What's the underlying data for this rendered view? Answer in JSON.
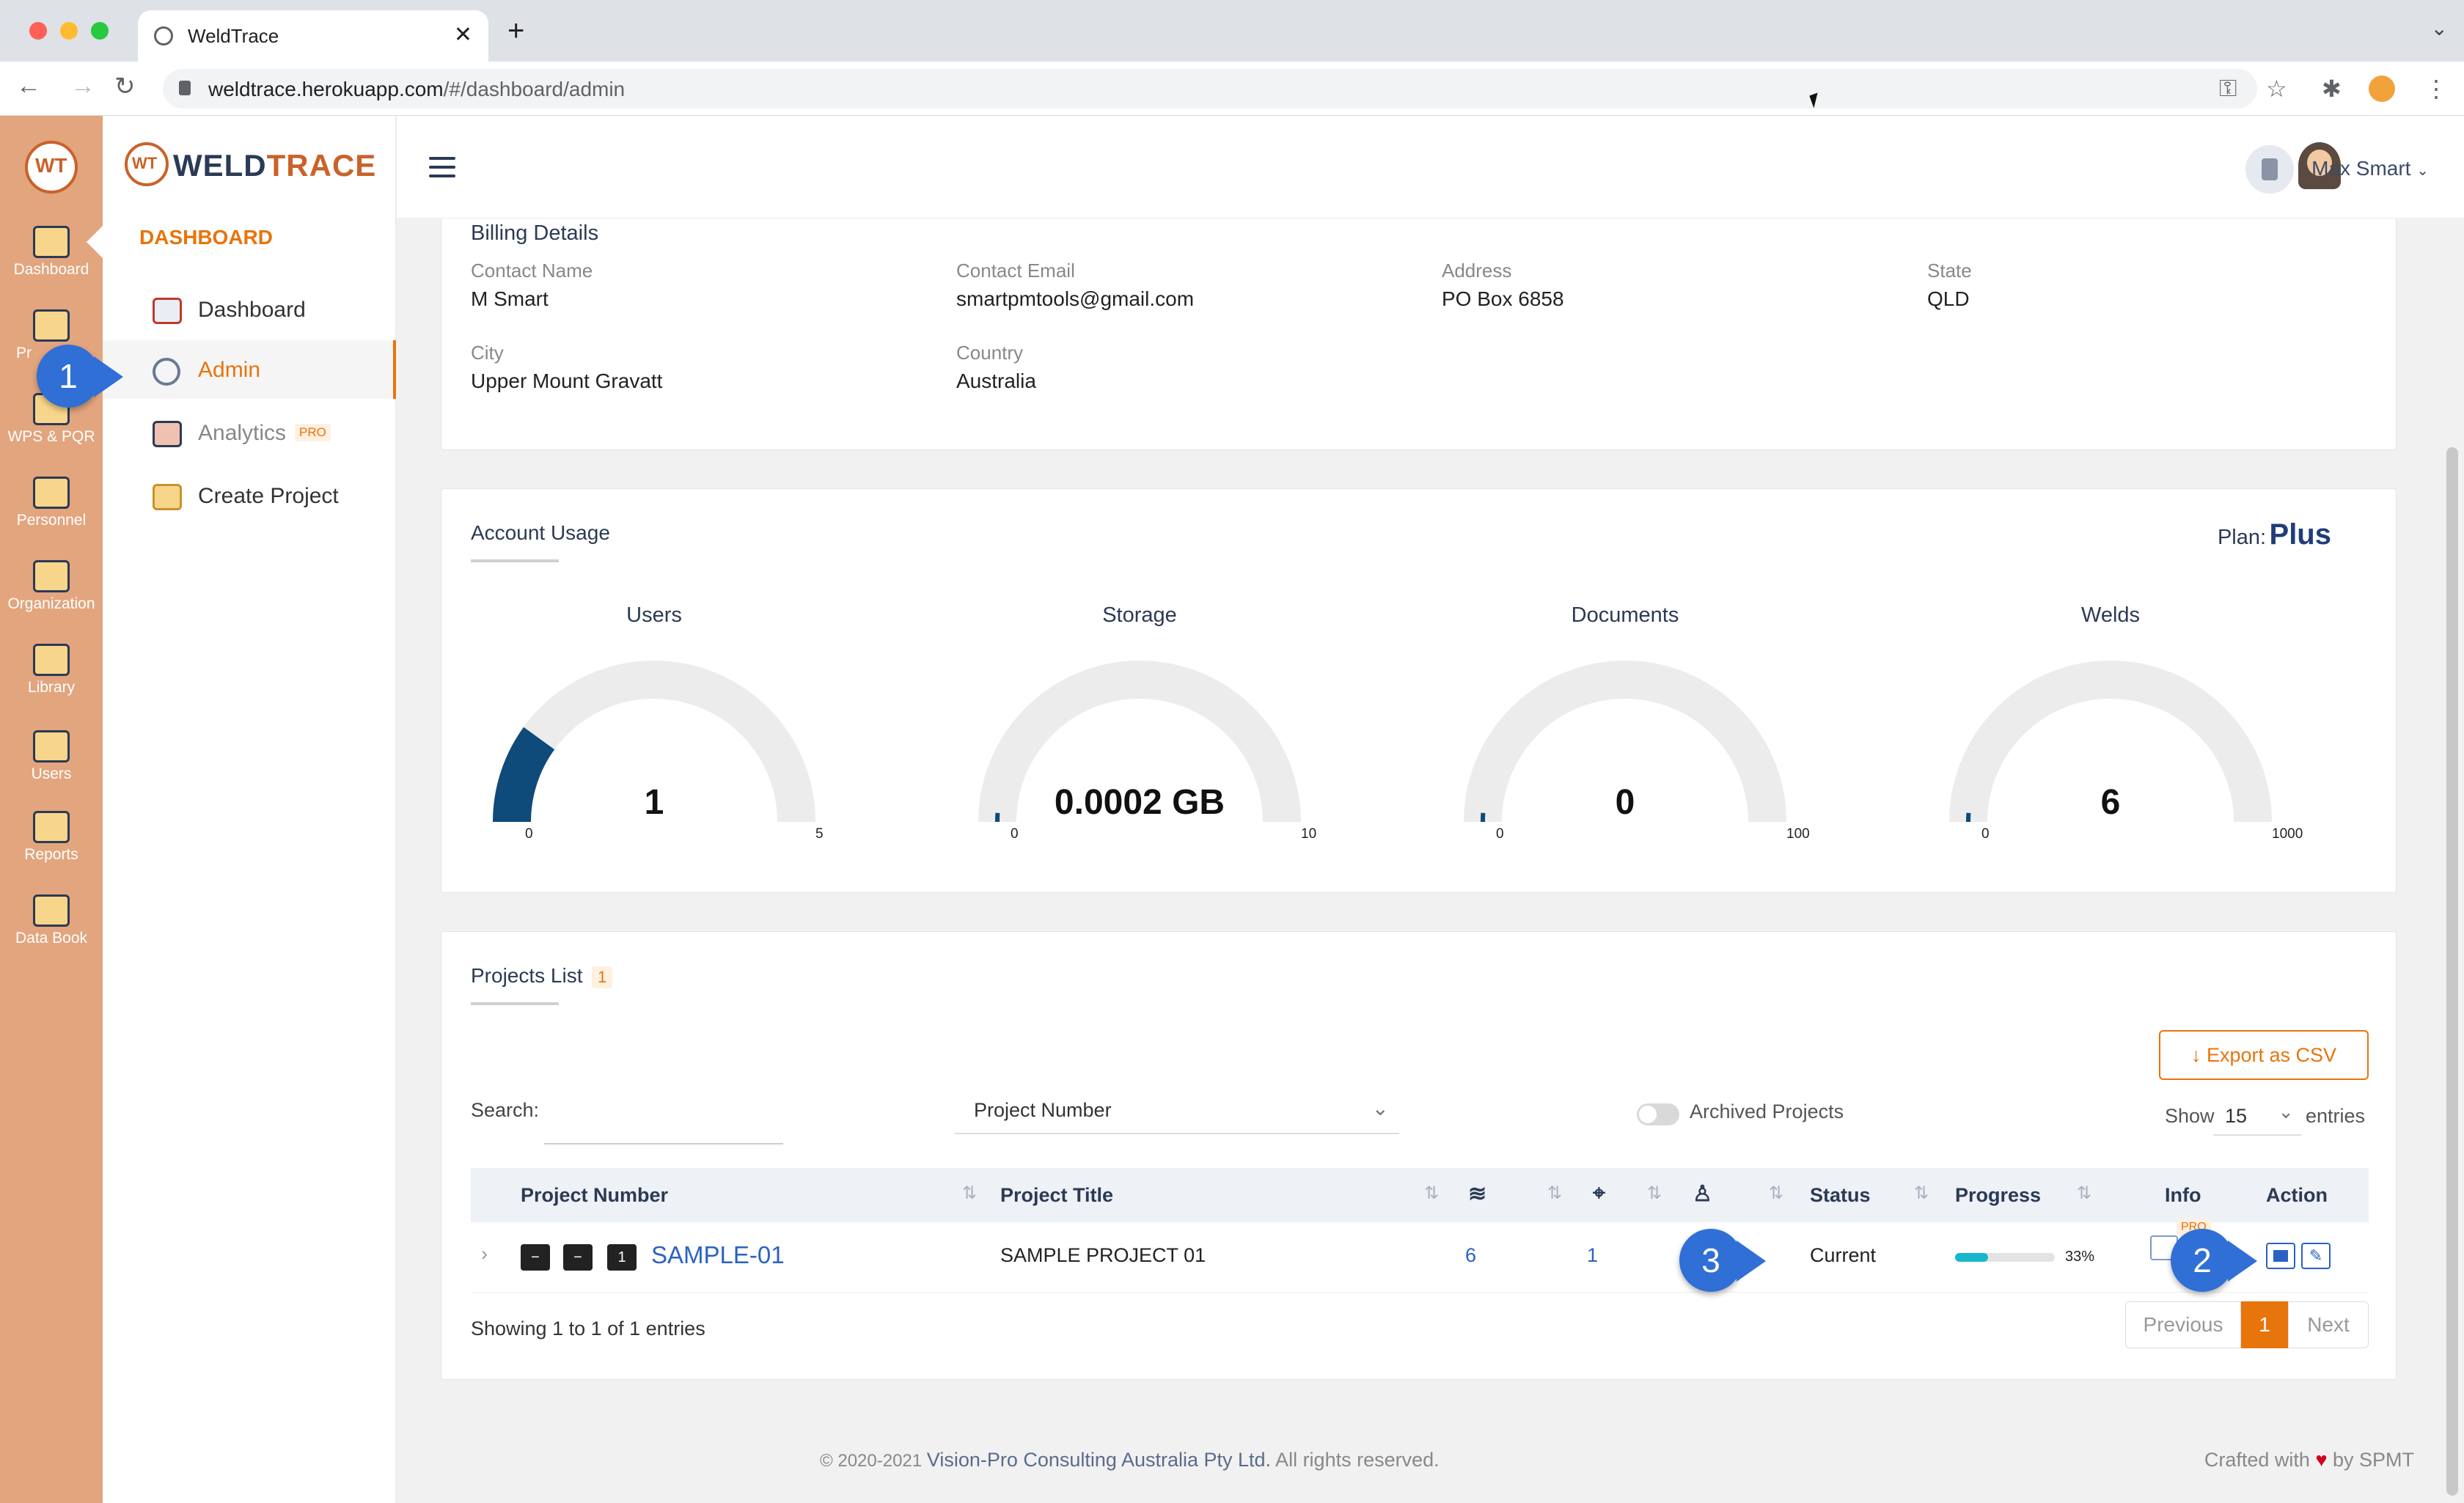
{
  "browser": {
    "tab_title": "WeldTrace",
    "url_host": "weldtrace.herokuapp.com",
    "url_path": "/#/dashboard/admin"
  },
  "rail": {
    "items": [
      {
        "label": "Dashboard",
        "icon": "monitor-icon"
      },
      {
        "label": "Pr",
        "icon": "folder-gear-icon"
      },
      {
        "label": "WPS & PQR",
        "icon": "document-gear-icon"
      },
      {
        "label": "Personnel",
        "icon": "welder-icon"
      },
      {
        "label": "Organization",
        "icon": "organization-icon"
      },
      {
        "label": "Library",
        "icon": "library-icon"
      },
      {
        "label": "Users",
        "icon": "users-icon"
      },
      {
        "label": "Reports",
        "icon": "reports-icon"
      },
      {
        "label": "Data Book",
        "icon": "data-book-icon"
      }
    ]
  },
  "sidebar": {
    "brand_prefix": "WELD",
    "brand_suffix": "TRACE",
    "brand_mark": "WT",
    "section_title": "DASHBOARD",
    "items": [
      {
        "label": "Dashboard",
        "icon": "chart-icon"
      },
      {
        "label": "Admin",
        "icon": "gear-icon"
      },
      {
        "label": "Analytics",
        "icon": "analytics-icon",
        "badge": "PRO"
      },
      {
        "label": "Create Project",
        "icon": "folder-add-icon"
      }
    ]
  },
  "header": {
    "user_name": "Max Smart"
  },
  "billing": {
    "title": "Billing Details",
    "fields": [
      {
        "label": "Contact Name",
        "value": "M Smart"
      },
      {
        "label": "Contact Email",
        "value": "smartpmtools@gmail.com"
      },
      {
        "label": "Address",
        "value": "PO Box 6858"
      },
      {
        "label": "State",
        "value": "QLD"
      },
      {
        "label": "City",
        "value": "Upper Mount Gravatt"
      },
      {
        "label": "Country",
        "value": "Australia"
      }
    ]
  },
  "usage": {
    "title": "Account Usage",
    "plan_label": "Plan:",
    "plan_value": "Plus",
    "gauges": [
      {
        "title": "Users",
        "display": "1",
        "min": "0",
        "max": "5",
        "fraction": 0.2
      },
      {
        "title": "Storage",
        "display": "0.0002 GB",
        "min": "0",
        "max": "10",
        "fraction": 0.02
      },
      {
        "title": "Documents",
        "display": "0",
        "min": "0",
        "max": "100",
        "fraction": 0.02
      },
      {
        "title": "Welds",
        "display": "6",
        "min": "0",
        "max": "1000",
        "fraction": 0.02
      }
    ],
    "colors": {
      "track": "#ececec",
      "fill": "#0e4a7a",
      "weld_tip": "#c0392b"
    }
  },
  "projects": {
    "title": "Projects List",
    "count": "1",
    "export_label": "Export as CSV",
    "search_label": "Search:",
    "filter_value": "Project Number",
    "archived_label": "Archived Projects",
    "show_label": "Show",
    "show_value": "15",
    "entries_label": "entries",
    "columns": [
      "Project Number",
      "Project Title",
      "Status",
      "Progress",
      "Info",
      "Action"
    ],
    "rows": [
      {
        "number": "SAMPLE-01",
        "title": "SAMPLE PROJECT 01",
        "welds": "6",
        "docs": "1",
        "status": "Current",
        "progress_text": "33%",
        "progress": 0.33,
        "info_badge": "PRO",
        "row_icons": [
          "−",
          "−",
          "1"
        ]
      }
    ],
    "footer_text": "Showing 1 to 1 of 1 entries",
    "pagination": {
      "prev": "Previous",
      "page": "1",
      "next": "Next"
    }
  },
  "callouts": [
    "1",
    "2",
    "3"
  ],
  "footer": {
    "copyright_prefix": "© 2020-2021 ",
    "company": "Vision-Pro Consulting Australia Pty Ltd.",
    "rights": " All rights reserved.",
    "crafted_prefix": "Crafted with ",
    "crafted_suffix": " by SPMT"
  },
  "accent": "#e8740c"
}
